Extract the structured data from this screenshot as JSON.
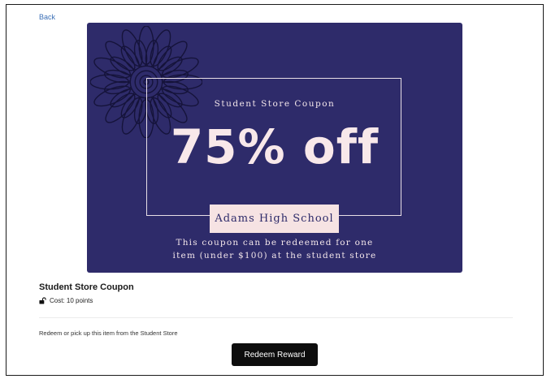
{
  "nav": {
    "back_label": "Back"
  },
  "coupon": {
    "subtitle": "Student Store Coupon",
    "discount": "75% off",
    "school": "Adams High School",
    "note_line1": "This coupon can be redeemed for one",
    "note_line2": "item (under $100) at the student store",
    "background_color": "#2e2b6a",
    "accent_color": "#f6e3e3",
    "decoration_icon": "sunflower-icon"
  },
  "item": {
    "title": "Student Store Coupon",
    "cost_text": "Cost: 10 points",
    "cost_icon": "unlock-icon"
  },
  "redeem": {
    "instructions": "Redeem or pick up this item from the Student Store",
    "button_label": "Redeem Reward"
  }
}
